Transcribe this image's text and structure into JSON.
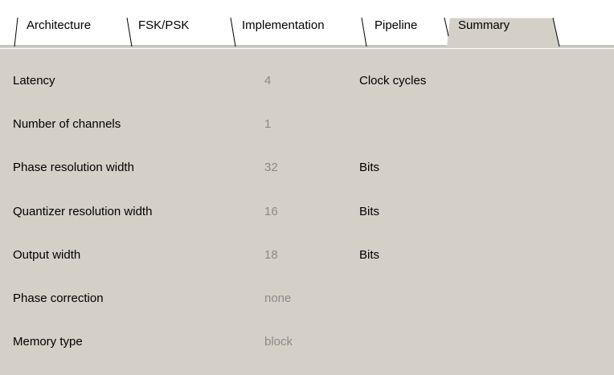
{
  "tabs": [
    {
      "label": "Architecture",
      "active": false
    },
    {
      "label": "FSK/PSK",
      "active": false
    },
    {
      "label": "Implementation",
      "active": false
    },
    {
      "label": "Pipeline",
      "active": false
    },
    {
      "label": "Summary",
      "active": true
    }
  ],
  "summary": {
    "rows": [
      {
        "label": "Latency",
        "value": "4",
        "unit": "Clock cycles"
      },
      {
        "label": "Number of channels",
        "value": "1",
        "unit": ""
      },
      {
        "label": "Phase resolution width",
        "value": "32",
        "unit": "Bits"
      },
      {
        "label": "Quantizer resolution width",
        "value": "16",
        "unit": "Bits"
      },
      {
        "label": "Output width",
        "value": "18",
        "unit": "Bits"
      },
      {
        "label": "Phase correction",
        "value": "none",
        "unit": ""
      },
      {
        "label": "Memory type",
        "value": "block",
        "unit": ""
      }
    ]
  }
}
